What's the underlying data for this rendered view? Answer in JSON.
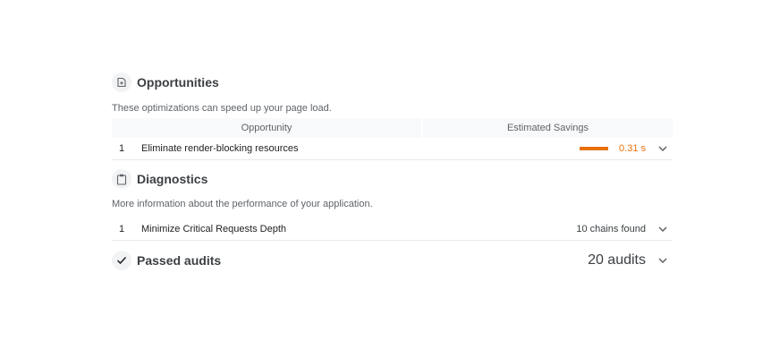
{
  "opportunities": {
    "title": "Opportunities",
    "description": "These optimizations can speed up your page load.",
    "columns": {
      "opportunity": "Opportunity",
      "savings": "Estimated Savings"
    },
    "icon": "opportunity-icon",
    "items": [
      {
        "index": "1",
        "title": "Eliminate render-blocking resources",
        "savings": "0.31 s",
        "savings_color": "#e8710a"
      }
    ]
  },
  "diagnostics": {
    "title": "Diagnostics",
    "description": "More information about the performance of your application.",
    "icon": "clipboard-icon",
    "items": [
      {
        "index": "1",
        "title": "Minimize Critical Requests Depth",
        "value": "10 chains found"
      }
    ]
  },
  "passed": {
    "title": "Passed audits",
    "value": "20 audits",
    "icon": "checkmark-icon"
  }
}
